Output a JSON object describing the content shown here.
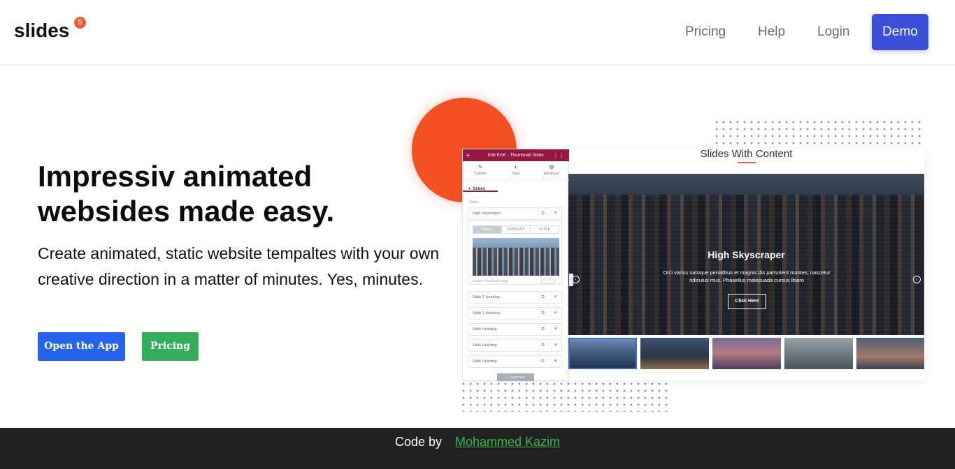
{
  "brand": {
    "name": "slides",
    "badge": "5"
  },
  "nav": {
    "links": [
      "Pricing",
      "Help",
      "Login"
    ],
    "demo_label": "Demo"
  },
  "hero": {
    "title": "Impressiv animated websides made easy.",
    "subtitle": "Create animated, static website tempaltes with your own creative direction in a matter of minutes. Yes, minutes.",
    "open_app_label": "Open the App",
    "pricing_label": "Pricing"
  },
  "preview": {
    "title": "Slides With Content",
    "slide_heading": "High Skyscraper",
    "slide_text": "Orci varius natoque penatibus et magnis dis parturient montes, nascetur ridiculus mus. Phasellus malesuada cursus libero",
    "slide_button": "Click Here"
  },
  "editor": {
    "header": "Edit EAE - Thumbnail Slider",
    "tabs": [
      "Content",
      "Style",
      "Advanced"
    ],
    "section": "Slides",
    "list_label": "Slides",
    "first_item": "High Skyscraper",
    "segments": [
      "IMAGE",
      "CONTENT",
      "STYLE"
    ],
    "thumbnail_label": "Custom Thumbnail Image",
    "items": [
      "Slide 2 Heading",
      "Slide 3 Heading",
      "Slide Heading",
      "Slide Heading",
      "Slide Heading"
    ],
    "add_item": "ADD ITEM"
  },
  "footer": {
    "text": "Code by",
    "author": "Mohammed Kazim"
  },
  "colors": {
    "demo_button": "#3b4fd8",
    "open_app_button": "#2563eb",
    "pricing_button": "#34ad5c",
    "accent_circle": "#f35023",
    "badge": "#f15a3b",
    "editor_header": "#93173f",
    "footer_bg": "#222222",
    "footer_link": "#3ab54a"
  }
}
